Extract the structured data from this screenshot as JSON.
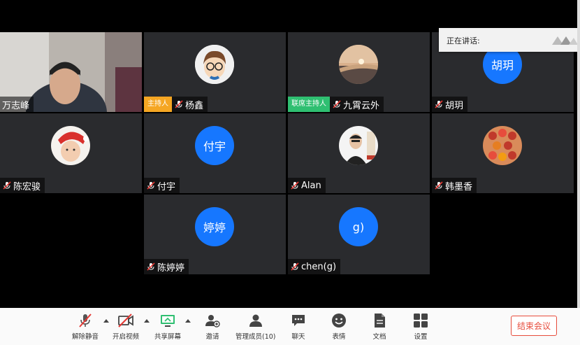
{
  "speaking_panel": {
    "label": "正在讲话:"
  },
  "participants": [
    {
      "name": "万志峰",
      "role": "",
      "type": "video"
    },
    {
      "name": "杨鑫",
      "role": "主持人",
      "type": "photo-cartoon"
    },
    {
      "name": "九霄云外",
      "role": "联席主持人",
      "type": "photo-sunset"
    },
    {
      "name": "胡玥",
      "role": "",
      "type": "text",
      "avatar_text": "胡玥"
    },
    {
      "name": "陈宏骏",
      "role": "",
      "type": "photo-child"
    },
    {
      "name": "付宇",
      "role": "",
      "type": "text",
      "avatar_text": "付宇"
    },
    {
      "name": "Alan",
      "role": "",
      "type": "photo-alan"
    },
    {
      "name": "韩墨香",
      "role": "",
      "type": "photo-food"
    },
    {
      "name": "陈婷婷",
      "role": "",
      "type": "text",
      "avatar_text": "婷婷"
    },
    {
      "name": "chen(g)",
      "role": "",
      "type": "text",
      "avatar_text": "g)"
    }
  ],
  "toolbar": {
    "unmute": "解除静音",
    "start_video": "开启视频",
    "share_screen": "共享屏幕",
    "invite": "邀请",
    "manage_members": "管理成员(10)",
    "chat": "聊天",
    "reactions": "表情",
    "documents": "文档",
    "settings": "设置",
    "end_meeting": "结束会议"
  },
  "colors": {
    "accent": "#1677ff",
    "host_badge": "#f5a623",
    "cohost_badge": "#2fbf71",
    "end": "#e74c3c",
    "mute_red": "#e53935"
  }
}
